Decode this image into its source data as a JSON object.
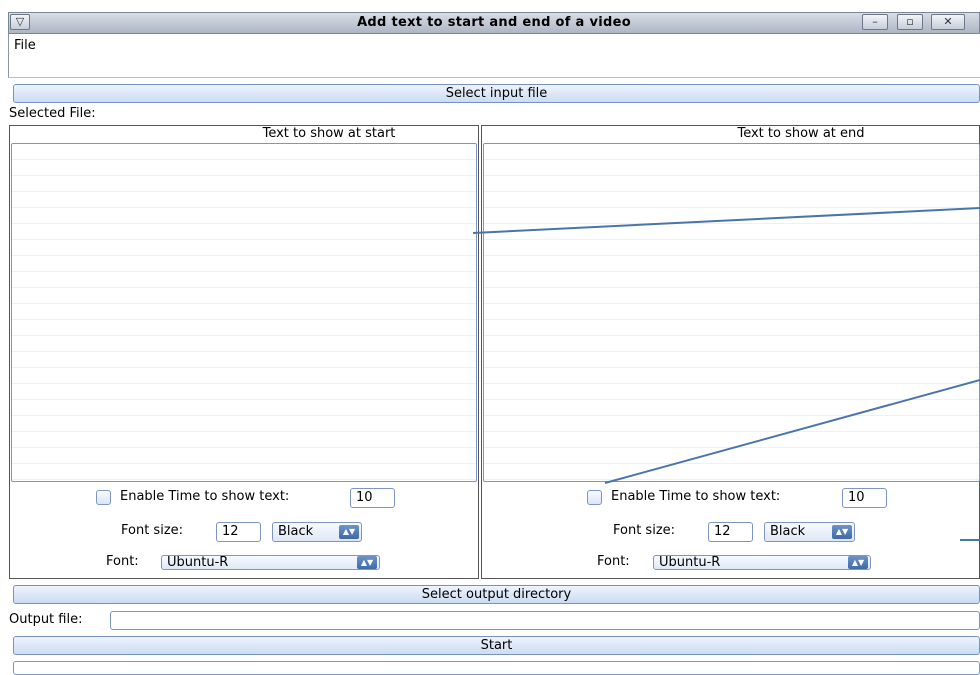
{
  "window": {
    "title": "Add text to start and end of a video",
    "menu_icon": "triangle-down-icon",
    "minimize_icon": "minimize-icon",
    "maximize_icon": "maximize-icon",
    "close_icon": "close-icon"
  },
  "menu": {
    "file_label": "File"
  },
  "input": {
    "select_button": "Select input file",
    "selected_file_label": "Selected File:"
  },
  "start_panel": {
    "title": "Text to show at start",
    "enable_time_label": "Enable Time to show text:",
    "time_value": "10",
    "font_size_label": "Font size:",
    "font_size_value": "12",
    "color_value": "Black",
    "font_label": "Font:",
    "font_value": "Ubuntu-R"
  },
  "end_panel": {
    "title": "Text to show at end",
    "enable_time_label": "Enable Time to show text:",
    "time_value": "10",
    "font_size_label": "Font size:",
    "font_size_value": "12",
    "color_value": "Black",
    "font_label": "Font:",
    "font_value": "Ubuntu-R"
  },
  "output": {
    "select_dir_button": "Select output directory",
    "output_file_label": "Output file:",
    "output_file_value": ""
  },
  "start_button": "Start"
}
